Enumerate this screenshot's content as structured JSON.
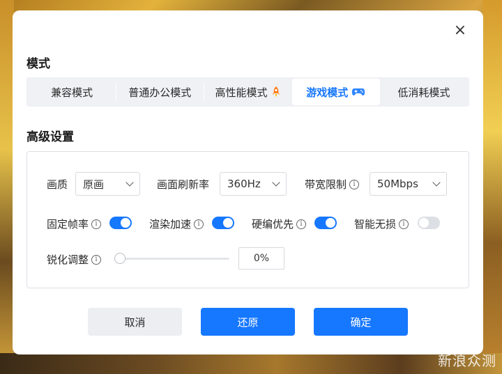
{
  "mode": {
    "title": "模式",
    "tabs": [
      {
        "label": "兼容模式",
        "active": false
      },
      {
        "label": "普通办公模式",
        "active": false
      },
      {
        "label": "高性能模式",
        "icon": "rocket-icon",
        "active": false
      },
      {
        "label": "游戏模式",
        "icon": "gamepad-icon",
        "active": true
      },
      {
        "label": "低消耗模式",
        "active": false
      }
    ]
  },
  "advanced": {
    "title": "高级设置",
    "quality": {
      "label": "画质",
      "value": "原画"
    },
    "refresh": {
      "label": "画面刷新率",
      "value": "360Hz"
    },
    "bandwidth": {
      "label": "带宽限制",
      "value": "50Mbps"
    },
    "fixed_fps": {
      "label": "固定帧率",
      "on": true
    },
    "render_accel": {
      "label": "渲染加速",
      "on": true
    },
    "hw_encode": {
      "label": "硬编优先",
      "on": true
    },
    "lossless": {
      "label": "智能无损",
      "on": false
    },
    "sharpen": {
      "label": "锐化调整",
      "value": "0%",
      "level": 0
    }
  },
  "buttons": {
    "cancel": "取消",
    "restore": "还原",
    "confirm": "确定"
  },
  "close_icon": "×",
  "info_glyph": "i",
  "watermark": "新浪众测",
  "colors": {
    "accent": "#1677ff",
    "toggle_off": "#dcdfe4"
  }
}
